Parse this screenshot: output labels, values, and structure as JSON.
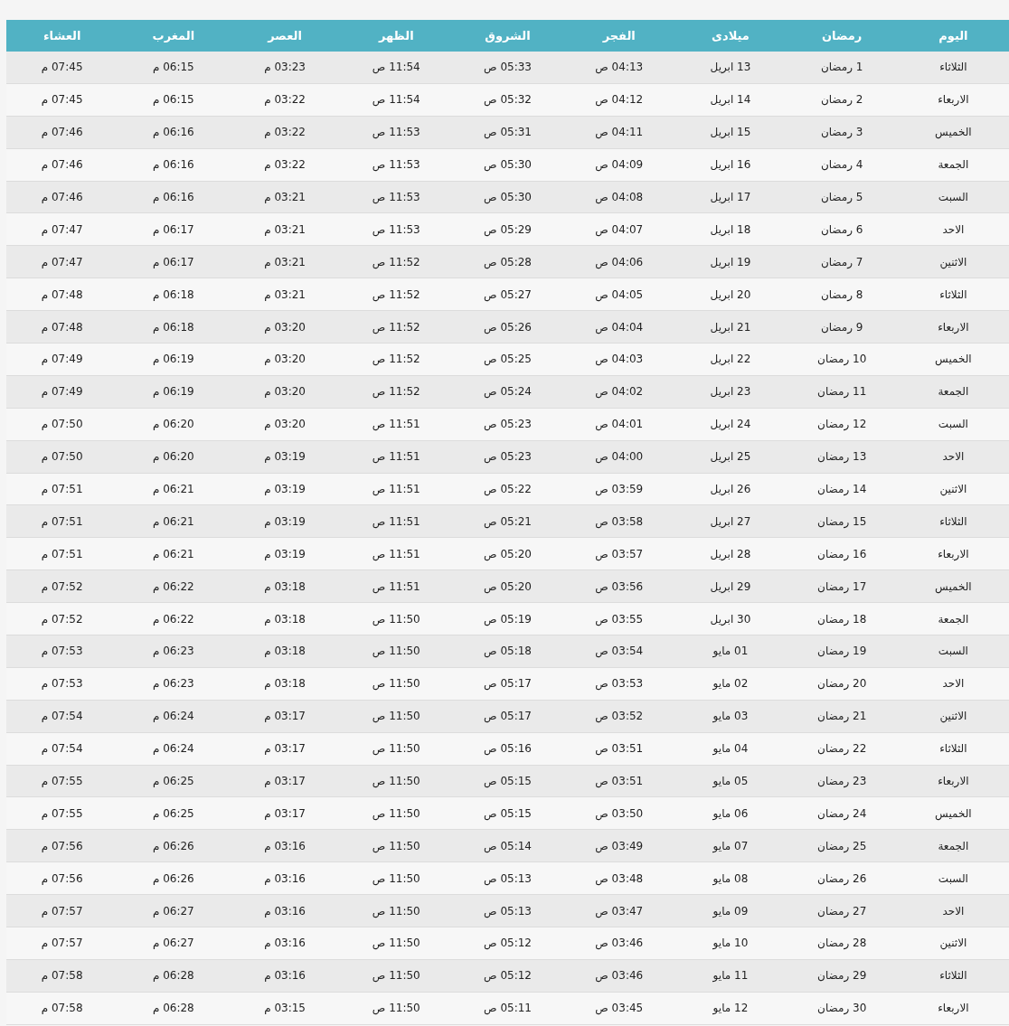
{
  "table": {
    "columns": [
      "اليوم",
      "رمضان",
      "ميلادى",
      "الفجر",
      "الشروق",
      "الظهر",
      "العصر",
      "المغرب",
      "العشاء"
    ],
    "rows": [
      [
        "الثلاثاء",
        "1 رمضان",
        "13 ابريل",
        "04:13 ص",
        "05:33 ص",
        "11:54 ص",
        "03:23 م",
        "06:15 م",
        "07:45 م"
      ],
      [
        "الاربعاء",
        "2 رمضان",
        "14 ابريل",
        "04:12 ص",
        "05:32 ص",
        "11:54 ص",
        "03:22 م",
        "06:15 م",
        "07:45 م"
      ],
      [
        "الخميس",
        "3 رمضان",
        "15 ابريل",
        "04:11 ص",
        "05:31 ص",
        "11:53 ص",
        "03:22 م",
        "06:16 م",
        "07:46 م"
      ],
      [
        "الجمعة",
        "4 رمضان",
        "16 ابريل",
        "04:09 ص",
        "05:30 ص",
        "11:53 ص",
        "03:22 م",
        "06:16 م",
        "07:46 م"
      ],
      [
        "السبت",
        "5 رمضان",
        "17 ابريل",
        "04:08 ص",
        "05:30 ص",
        "11:53 ص",
        "03:21 م",
        "06:16 م",
        "07:46 م"
      ],
      [
        "الاحد",
        "6 رمضان",
        "18 ابريل",
        "04:07 ص",
        "05:29 ص",
        "11:53 ص",
        "03:21 م",
        "06:17 م",
        "07:47 م"
      ],
      [
        "الاثنين",
        "7 رمضان",
        "19 ابريل",
        "04:06 ص",
        "05:28 ص",
        "11:52 ص",
        "03:21 م",
        "06:17 م",
        "07:47 م"
      ],
      [
        "الثلاثاء",
        "8 رمضان",
        "20 ابريل",
        "04:05 ص",
        "05:27 ص",
        "11:52 ص",
        "03:21 م",
        "06:18 م",
        "07:48 م"
      ],
      [
        "الاربعاء",
        "9 رمضان",
        "21 ابريل",
        "04:04 ص",
        "05:26 ص",
        "11:52 ص",
        "03:20 م",
        "06:18 م",
        "07:48 م"
      ],
      [
        "الخميس",
        "10 رمضان",
        "22 ابريل",
        "04:03 ص",
        "05:25 ص",
        "11:52 ص",
        "03:20 م",
        "06:19 م",
        "07:49 م"
      ],
      [
        "الجمعة",
        "11 رمضان",
        "23 ابريل",
        "04:02 ص",
        "05:24 ص",
        "11:52 ص",
        "03:20 م",
        "06:19 م",
        "07:49 م"
      ],
      [
        "السبت",
        "12 رمضان",
        "24 ابريل",
        "04:01 ص",
        "05:23 ص",
        "11:51 ص",
        "03:20 م",
        "06:20 م",
        "07:50 م"
      ],
      [
        "الاحد",
        "13 رمضان",
        "25 ابريل",
        "04:00 ص",
        "05:23 ص",
        "11:51 ص",
        "03:19 م",
        "06:20 م",
        "07:50 م"
      ],
      [
        "الاثنين",
        "14 رمضان",
        "26 ابريل",
        "03:59 ص",
        "05:22 ص",
        "11:51 ص",
        "03:19 م",
        "06:21 م",
        "07:51 م"
      ],
      [
        "الثلاثاء",
        "15 رمضان",
        "27 ابريل",
        "03:58 ص",
        "05:21 ص",
        "11:51 ص",
        "03:19 م",
        "06:21 م",
        "07:51 م"
      ],
      [
        "الاربعاء",
        "16 رمضان",
        "28 ابريل",
        "03:57 ص",
        "05:20 ص",
        "11:51 ص",
        "03:19 م",
        "06:21 م",
        "07:51 م"
      ],
      [
        "الخميس",
        "17 رمضان",
        "29 ابريل",
        "03:56 ص",
        "05:20 ص",
        "11:51 ص",
        "03:18 م",
        "06:22 م",
        "07:52 م"
      ],
      [
        "الجمعة",
        "18 رمضان",
        "30 ابريل",
        "03:55 ص",
        "05:19 ص",
        "11:50 ص",
        "03:18 م",
        "06:22 م",
        "07:52 م"
      ],
      [
        "السبت",
        "19 رمضان",
        "01 مايو",
        "03:54 ص",
        "05:18 ص",
        "11:50 ص",
        "03:18 م",
        "06:23 م",
        "07:53 م"
      ],
      [
        "الاحد",
        "20 رمضان",
        "02 مايو",
        "03:53 ص",
        "05:17 ص",
        "11:50 ص",
        "03:18 م",
        "06:23 م",
        "07:53 م"
      ],
      [
        "الاثنين",
        "21 رمضان",
        "03 مايو",
        "03:52 ص",
        "05:17 ص",
        "11:50 ص",
        "03:17 م",
        "06:24 م",
        "07:54 م"
      ],
      [
        "الثلاثاء",
        "22 رمضان",
        "04 مايو",
        "03:51 ص",
        "05:16 ص",
        "11:50 ص",
        "03:17 م",
        "06:24 م",
        "07:54 م"
      ],
      [
        "الاربعاء",
        "23 رمضان",
        "05 مايو",
        "03:51 ص",
        "05:15 ص",
        "11:50 ص",
        "03:17 م",
        "06:25 م",
        "07:55 م"
      ],
      [
        "الخميس",
        "24 رمضان",
        "06 مايو",
        "03:50 ص",
        "05:15 ص",
        "11:50 ص",
        "03:17 م",
        "06:25 م",
        "07:55 م"
      ],
      [
        "الجمعة",
        "25 رمضان",
        "07 مايو",
        "03:49 ص",
        "05:14 ص",
        "11:50 ص",
        "03:16 م",
        "06:26 م",
        "07:56 م"
      ],
      [
        "السبت",
        "26 رمضان",
        "08 مايو",
        "03:48 ص",
        "05:13 ص",
        "11:50 ص",
        "03:16 م",
        "06:26 م",
        "07:56 م"
      ],
      [
        "الاحد",
        "27 رمضان",
        "09 مايو",
        "03:47 ص",
        "05:13 ص",
        "11:50 ص",
        "03:16 م",
        "06:27 م",
        "07:57 م"
      ],
      [
        "الاثنين",
        "28 رمضان",
        "10 مايو",
        "03:46 ص",
        "05:12 ص",
        "11:50 ص",
        "03:16 م",
        "06:27 م",
        "07:57 م"
      ],
      [
        "الثلاثاء",
        "29 رمضان",
        "11 مايو",
        "03:46 ص",
        "05:12 ص",
        "11:50 ص",
        "03:16 م",
        "06:28 م",
        "07:58 م"
      ],
      [
        "الاربعاء",
        "30 رمضان",
        "12 مايو",
        "03:45 ص",
        "05:11 ص",
        "11:50 ص",
        "03:15 م",
        "06:28 م",
        "07:58 م"
      ]
    ]
  }
}
